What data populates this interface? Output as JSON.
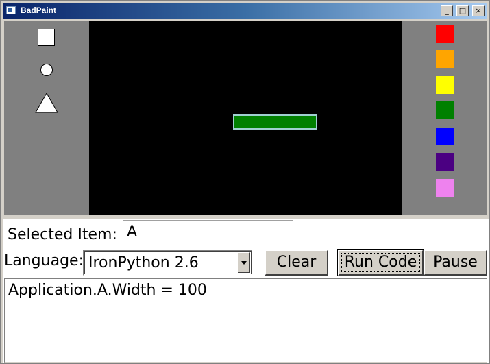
{
  "window": {
    "title": "BadPaint",
    "minimize_glyph": "_",
    "maximize_glyph": "□",
    "close_glyph": "×"
  },
  "toolbox": {
    "shapes": [
      {
        "name": "square",
        "icon": "square-icon"
      },
      {
        "name": "circle",
        "icon": "circle-icon"
      },
      {
        "name": "triangle",
        "icon": "triangle-icon"
      }
    ]
  },
  "palette": {
    "colors": [
      "#ff0000",
      "#ffa500",
      "#ffff00",
      "#008000",
      "#0000ff",
      "#4b0082",
      "#ee82ee"
    ]
  },
  "canvas": {
    "background": "#000000",
    "items": [
      {
        "name": "A",
        "fill": "#008000",
        "stroke": "#9fd0d0"
      }
    ]
  },
  "controls": {
    "selected_item_label": "Selected Item:",
    "selected_item_value": "A",
    "language_label": "Language:",
    "language_value": "IronPython 2.6",
    "clear_label": "Clear",
    "run_label": "Run Code",
    "pause_label": "Pause"
  },
  "code": {
    "text": "Application.A.Width = 100"
  }
}
